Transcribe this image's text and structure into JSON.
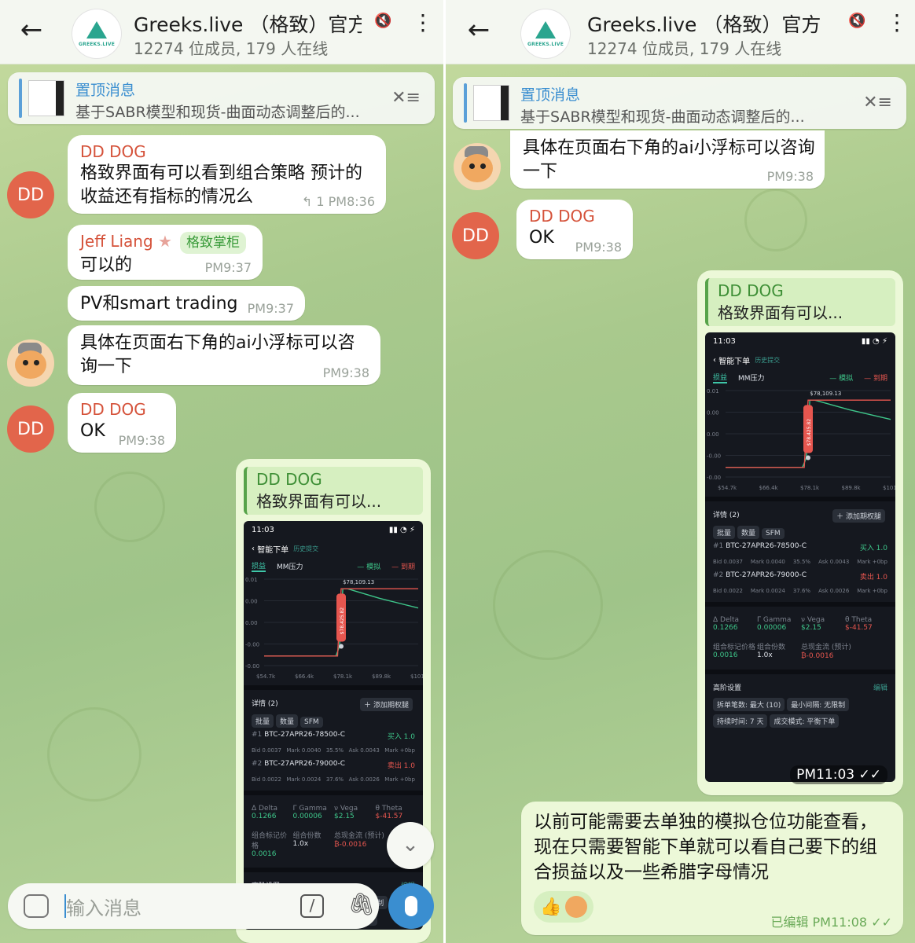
{
  "colors": {
    "accent": "#3a8ed0",
    "sender_red": "#d5523a",
    "admin_green": "#3a9b3a",
    "outgoing_bg": "#ecf8d8"
  },
  "chat": {
    "title": "Greeks.live （格致）官方",
    "subtitle": "12274 位成员, 179 人在线",
    "logo_text": "GREEKS.LIVE",
    "icons": {
      "back": "arrow-left-icon",
      "mute": "mute-icon",
      "more": "more-vertical-icon"
    }
  },
  "pinned": {
    "label": "置顶消息",
    "text": "基于SABR模型和现货-曲面动态调整后的..."
  },
  "left_messages": [
    {
      "sender": "DD DOG",
      "avatar": "DD",
      "text": "格致界面有可以看到组合策略 预计的收益还有指标的情况么",
      "replies": "1",
      "time": "PM8:36"
    },
    {
      "sender": "Jeff Liang",
      "badge": "格致掌柜",
      "text": "可以的",
      "time": "PM9:37"
    },
    {
      "text": "PV和smart trading",
      "time": "PM9:37"
    },
    {
      "text": "具体在页面右下角的ai小浮标可以咨询一下",
      "time": "PM9:38"
    },
    {
      "sender": "DD DOG",
      "avatar": "DD",
      "text": "OK",
      "time": "PM9:38"
    }
  ],
  "quote": {
    "name": "DD DOG",
    "text": "格致界面有可以..."
  },
  "phone": {
    "status_time": "11:03",
    "nav_title": "智能下单",
    "nav_history": "历史提交",
    "tabs": [
      "损益",
      "MM压力"
    ],
    "legend": [
      "模拟",
      "到期"
    ],
    "chart_data": {
      "type": "line",
      "x_ticks": [
        "$54.7k",
        "$66.4k",
        "$78.1k",
        "$89.8k",
        "$101.5k"
      ],
      "y_ticks": [
        "0.01",
        "0.00",
        "0.00",
        "-0.00",
        "-0.00"
      ],
      "peak_label": "$78,109.13",
      "marker_label": "$78,425.82",
      "series": [
        {
          "name": "模拟",
          "x": [
            54.7,
            66.4,
            76.5,
            77.6,
            78.1,
            78.6,
            80.0,
            89.8,
            101.5
          ],
          "y": [
            -0.004,
            -0.004,
            -0.004,
            -0.002,
            0.004,
            0.01,
            0.01,
            0.008,
            0.006
          ]
        },
        {
          "name": "到期",
          "x": [
            54.7,
            66.4,
            77.0,
            78.1,
            101.5
          ],
          "y": [
            -0.004,
            -0.004,
            -0.004,
            0.01,
            0.01
          ]
        }
      ]
    },
    "details_title": "详情 (2)",
    "details_filters": [
      "批量",
      "数量",
      "SFM"
    ],
    "add_button": "添加期权腿",
    "legs": [
      {
        "index": "#1",
        "name": "BTC-27APR26-78500-C",
        "side": "买入 1.0",
        "bid": "Bid 0.0037",
        "mark": "Mark 0.0040",
        "iv": "35.5%",
        "ask": "Ask 0.0043",
        "mark_text": "Mark +0bp"
      },
      {
        "index": "#2",
        "name": "BTC-27APR26-79000-C",
        "side": "卖出 1.0",
        "bid": "Bid 0.0022",
        "mark": "Mark 0.0024",
        "iv": "37.6%",
        "ask": "Ask 0.0026",
        "mark_text": "Mark +0bp"
      }
    ],
    "greeks": [
      {
        "label": "Δ Delta",
        "value": "0.1266"
      },
      {
        "label": "Γ Gamma",
        "value": "0.00006"
      },
      {
        "label": "ν Vega",
        "value": "$2.15"
      },
      {
        "label": "θ Theta",
        "value": "$-41.57"
      }
    ],
    "combo": [
      {
        "label": "组合标记价格",
        "value": "0.0016"
      },
      {
        "label": "组合份数",
        "value": "1.0x"
      },
      {
        "label": "总现金流 (预计)",
        "value": "₿-0.0016"
      }
    ],
    "advanced_title": "高阶设置",
    "advanced_edit": "编辑",
    "advanced_pills": [
      "拆单笔数: 最大 (10)",
      "最小间隔: 无限制",
      "持续时间: 7 天",
      "成交模式: 平衡下单"
    ]
  },
  "right_top": {
    "text": "具体在页面右下角的ai小浮标可以咨询一下",
    "time": "PM9:38"
  },
  "right_ok": {
    "sender": "DD DOG",
    "avatar": "DD",
    "text": "OK",
    "time": "PM9:38"
  },
  "screenshot_time": "PM11:03",
  "final_message": {
    "text": "以前可能需要去单独的模拟仓位功能查看，现在只需要智能下单就可以看自己要下的组合损益以及一些希腊字母情况",
    "meta": "已编辑 PM11:08",
    "reactions": [
      "thumbs-up-icon"
    ]
  },
  "input": {
    "placeholder": "输入消息",
    "icons": [
      "emoji-icon",
      "command-icon",
      "attach-icon",
      "mic-icon"
    ]
  }
}
